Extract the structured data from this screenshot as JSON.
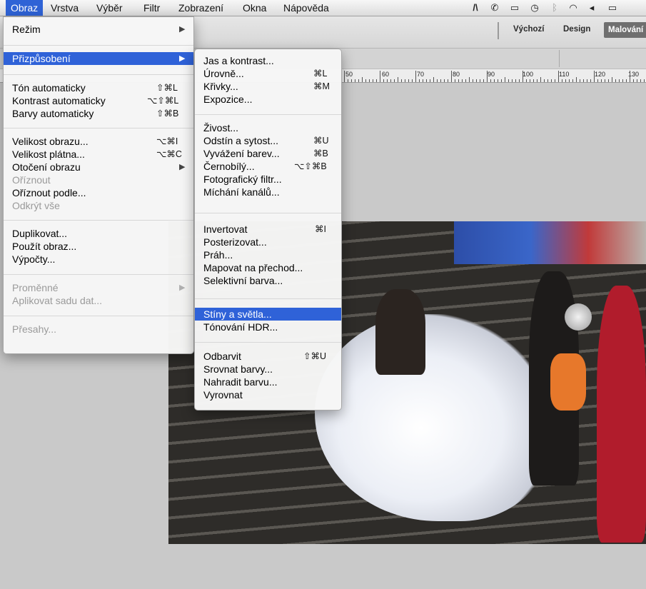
{
  "menubar": {
    "items": [
      "Obraz",
      "Vrstva",
      "Výběr",
      "Filtr",
      "Zobrazení",
      "Okna",
      "Nápověda"
    ]
  },
  "status_icons": [
    "adobe-icon",
    "phone-icon",
    "screen-icon",
    "time-machine-icon",
    "bluetooth-icon",
    "wifi-icon",
    "volume-icon",
    "battery-icon"
  ],
  "workspaces": {
    "items": [
      "Výchozí",
      "Design",
      "Malování"
    ],
    "active": "Malování"
  },
  "ruler": {
    "labels": [
      "50",
      "60",
      "70",
      "80",
      "90",
      "100",
      "110",
      "120",
      "130"
    ]
  },
  "image_menu": {
    "items": [
      {
        "label": "Režim",
        "submenu": true
      },
      {
        "label": "Přizpůsobení",
        "submenu": true,
        "highlight": true
      },
      {
        "label": "Tón automaticky",
        "shortcut": "⇧⌘L"
      },
      {
        "label": "Kontrast automaticky",
        "shortcut": "⌥⇧⌘L"
      },
      {
        "label": "Barvy automaticky",
        "shortcut": "⇧⌘B"
      },
      {
        "label": "Velikost obrazu...",
        "shortcut": "⌥⌘I"
      },
      {
        "label": "Velikost plátna...",
        "shortcut": "⌥⌘C"
      },
      {
        "label": "Otočení obrazu",
        "submenu": true
      },
      {
        "label": "Oříznout",
        "disabled": true
      },
      {
        "label": "Oříznout podle..."
      },
      {
        "label": "Odkrýt vše",
        "disabled": true
      },
      {
        "label": "Duplikovat..."
      },
      {
        "label": "Použít obraz..."
      },
      {
        "label": "Výpočty..."
      },
      {
        "label": "Proměnné",
        "submenu": true,
        "disabled": true
      },
      {
        "label": "Aplikovat sadu dat...",
        "disabled": true
      },
      {
        "label": "Přesahy...",
        "disabled": true
      }
    ]
  },
  "adjust_menu": {
    "items": [
      {
        "label": "Jas a kontrast..."
      },
      {
        "label": "Úrovně...",
        "shortcut": "⌘L"
      },
      {
        "label": "Křivky...",
        "shortcut": "⌘M"
      },
      {
        "label": "Expozice..."
      },
      {
        "label": "Živost..."
      },
      {
        "label": "Odstín a sytost...",
        "shortcut": "⌘U"
      },
      {
        "label": "Vyvážení barev...",
        "shortcut": "⌘B"
      },
      {
        "label": "Černobílý...",
        "shortcut": "⌥⇧⌘B"
      },
      {
        "label": "Fotografický filtr..."
      },
      {
        "label": "Míchání kanálů..."
      },
      {
        "label": "Invertovat",
        "shortcut": "⌘I"
      },
      {
        "label": "Posterizovat..."
      },
      {
        "label": "Práh..."
      },
      {
        "label": "Mapovat na přechod..."
      },
      {
        "label": "Selektivní barva..."
      },
      {
        "label": "Stíny a světla...",
        "highlight": true
      },
      {
        "label": "Tónování HDR..."
      },
      {
        "label": "Odbarvit",
        "shortcut": "⇧⌘U"
      },
      {
        "label": "Srovnat barvy..."
      },
      {
        "label": "Nahradit barvu..."
      },
      {
        "label": "Vyrovnat"
      }
    ]
  }
}
